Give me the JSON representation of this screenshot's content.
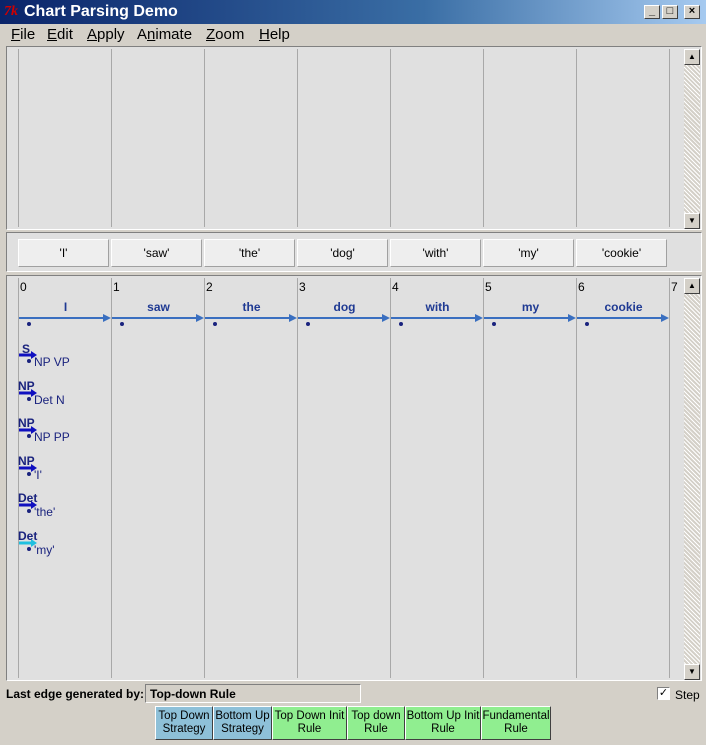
{
  "window": {
    "title": "Chart Parsing Demo",
    "controls": [
      "_",
      "□",
      "×"
    ]
  },
  "menu": [
    {
      "pre": "",
      "u": "F",
      "post": "ile"
    },
    {
      "pre": "",
      "u": "E",
      "post": "dit"
    },
    {
      "pre": "",
      "u": "A",
      "post": "pply"
    },
    {
      "pre": "A",
      "u": "n",
      "post": "imate"
    },
    {
      "pre": "",
      "u": "Z",
      "post": "oom"
    },
    {
      "pre": "",
      "u": "H",
      "post": "elp"
    }
  ],
  "tokens": [
    "'I'",
    "'saw'",
    "'the'",
    "'dog'",
    "'with'",
    "'my'",
    "'cookie'"
  ],
  "chart": {
    "indices": [
      "0",
      "1",
      "2",
      "3",
      "4",
      "5",
      "6",
      "7"
    ],
    "words": [
      "I",
      "saw",
      "the",
      "dog",
      "with",
      "my",
      "cookie"
    ],
    "edges": [
      {
        "lhs": "S",
        "rhs": "NP VP",
        "color": "#1010c0"
      },
      {
        "lhs": "NP",
        "rhs": "Det N",
        "color": "#1010c0"
      },
      {
        "lhs": "NP",
        "rhs": "NP PP",
        "color": "#1010c0"
      },
      {
        "lhs": "NP",
        "rhs": "'I'",
        "color": "#1010c0"
      },
      {
        "lhs": "Det",
        "rhs": "'the'",
        "color": "#1010c0"
      },
      {
        "lhs": "Det",
        "rhs": "'my'",
        "color": "#20c0e0"
      }
    ]
  },
  "status": {
    "label": "Last edge generated by:",
    "value": "Top-down Rule",
    "step_label": "Step",
    "step_checked": "✓"
  },
  "buttons": [
    {
      "line1": "Top Down",
      "line2": "Strategy",
      "color": "#8ec0d8"
    },
    {
      "line1": "Bottom Up",
      "line2": "Strategy",
      "color": "#8ec0d8"
    },
    {
      "line1": "Top Down Init",
      "line2": "Rule",
      "color": "#90ee90"
    },
    {
      "line1": "Top down",
      "line2": "Rule",
      "color": "#90ee90"
    },
    {
      "line1": "Bottom Up Init",
      "line2": "Rule",
      "color": "#90ee90"
    },
    {
      "line1": "Fundamental",
      "line2": "Rule",
      "color": "#90ee90"
    }
  ]
}
